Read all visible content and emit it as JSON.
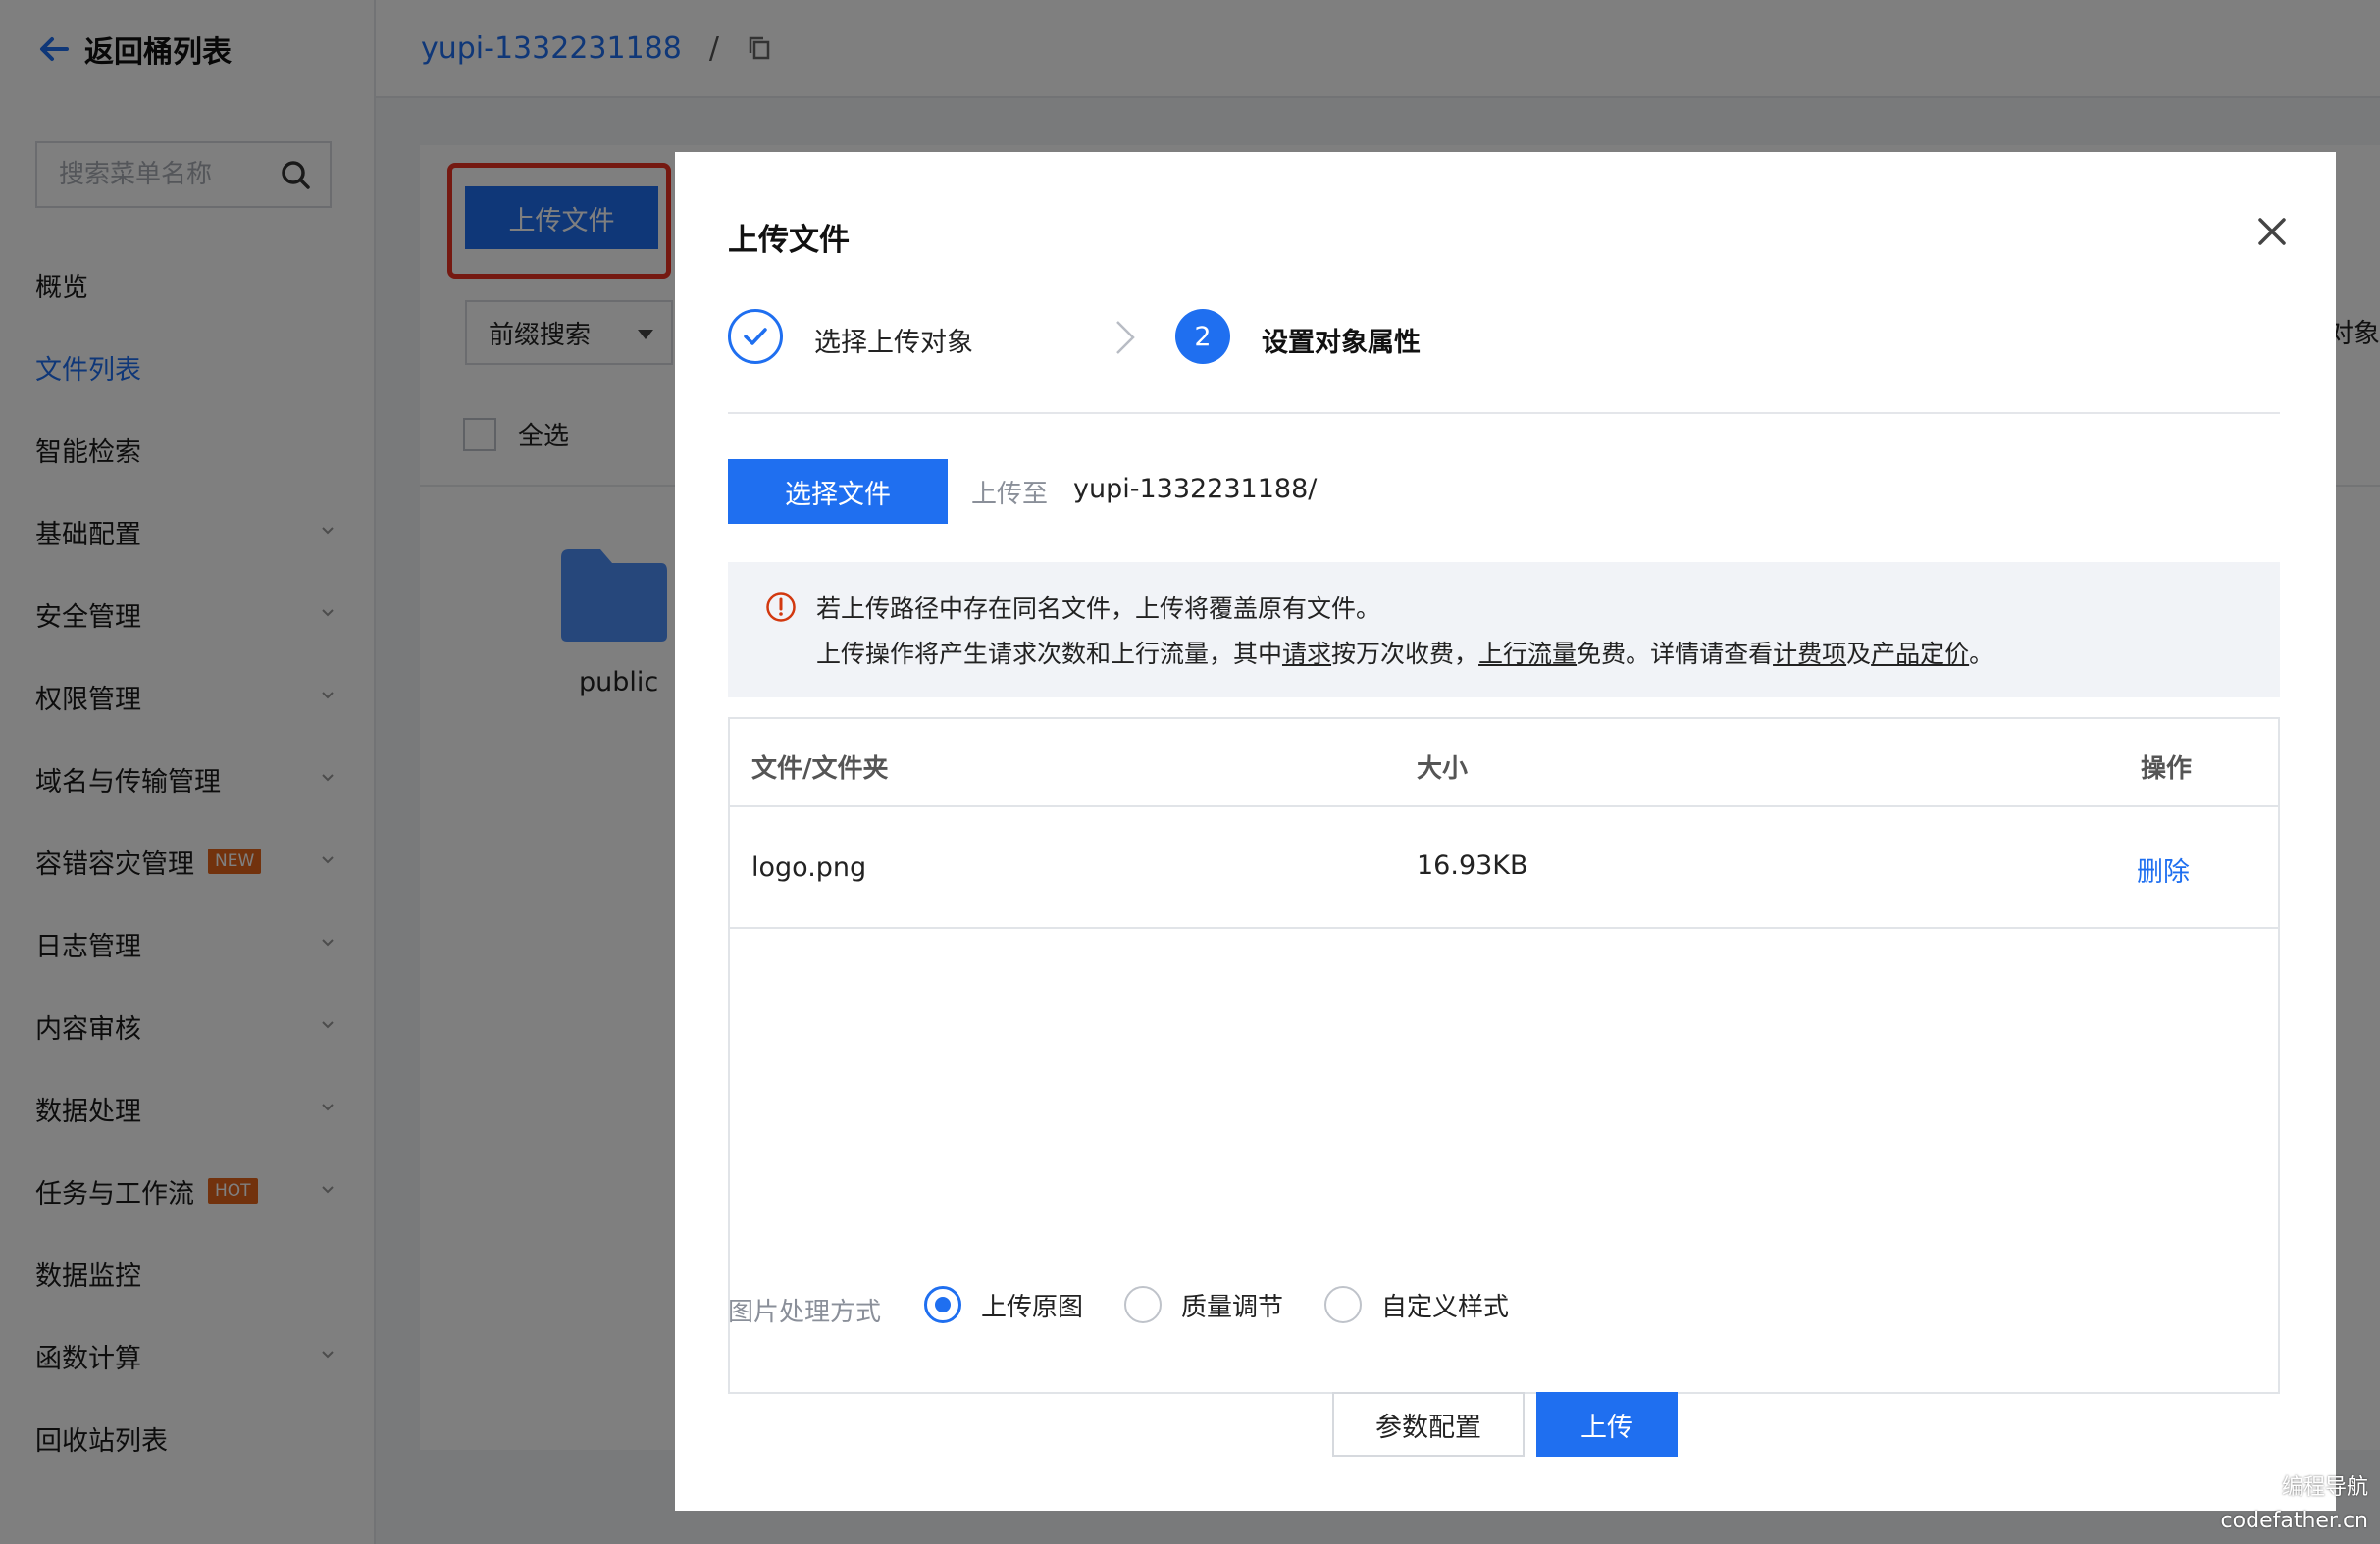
{
  "sidebar": {
    "back_label": "返回桶列表",
    "search_placeholder": "搜索菜单名称",
    "items": [
      {
        "label": "概览"
      },
      {
        "label": "文件列表"
      },
      {
        "label": "智能检索"
      },
      {
        "label": "基础配置"
      },
      {
        "label": "安全管理"
      },
      {
        "label": "权限管理"
      },
      {
        "label": "域名与传输管理"
      },
      {
        "label": "容错容灾管理",
        "badge": "NEW"
      },
      {
        "label": "日志管理"
      },
      {
        "label": "内容审核"
      },
      {
        "label": "数据处理"
      },
      {
        "label": "任务与工作流",
        "badge": "HOT"
      },
      {
        "label": "数据监控"
      },
      {
        "label": "函数计算"
      },
      {
        "label": "回收站列表"
      }
    ]
  },
  "header": {
    "bucket": "yupi-1332231188",
    "separator": "/"
  },
  "background": {
    "upload_button": "上传文件",
    "prefix_search": "前缀搜索",
    "select_all": "全选",
    "folder_name": "public",
    "right_text": "对象"
  },
  "modal": {
    "title": "上传文件",
    "steps": {
      "step1": "选择上传对象",
      "step2_number": "2",
      "step2": "设置对象属性"
    },
    "choose_file": "选择文件",
    "upload_to_label": "上传至",
    "upload_to_path": "yupi-1332231188/",
    "notice": {
      "line1": "若上传路径中存在同名文件，上传将覆盖原有文件。",
      "line2_a": "上传操作将产生请求次数和上行流量，其中",
      "line2_b": "请求",
      "line2_c": "按万次收费，",
      "line2_d": "上行流量",
      "line2_e": "免费。详情请查看",
      "line2_f": "计费项",
      "line2_g": "及",
      "line2_h": "产品定价",
      "line2_i": "。"
    },
    "table": {
      "headers": [
        "文件/文件夹",
        "大小",
        "操作"
      ],
      "rows": [
        {
          "name": "logo.png",
          "size": "16.93KB",
          "action": "删除"
        }
      ]
    },
    "image_processing": {
      "label": "图片处理方式",
      "options": [
        "上传原图",
        "质量调节",
        "自定义样式"
      ],
      "selected": "上传原图"
    },
    "buttons": {
      "params": "参数配置",
      "upload": "上传"
    }
  },
  "watermark": {
    "line1": "编程导航",
    "line2": "codefather.cn"
  },
  "colors": {
    "accent": "#1f6ff0",
    "badge": "#e5651b",
    "highlight": "#ea3323"
  }
}
